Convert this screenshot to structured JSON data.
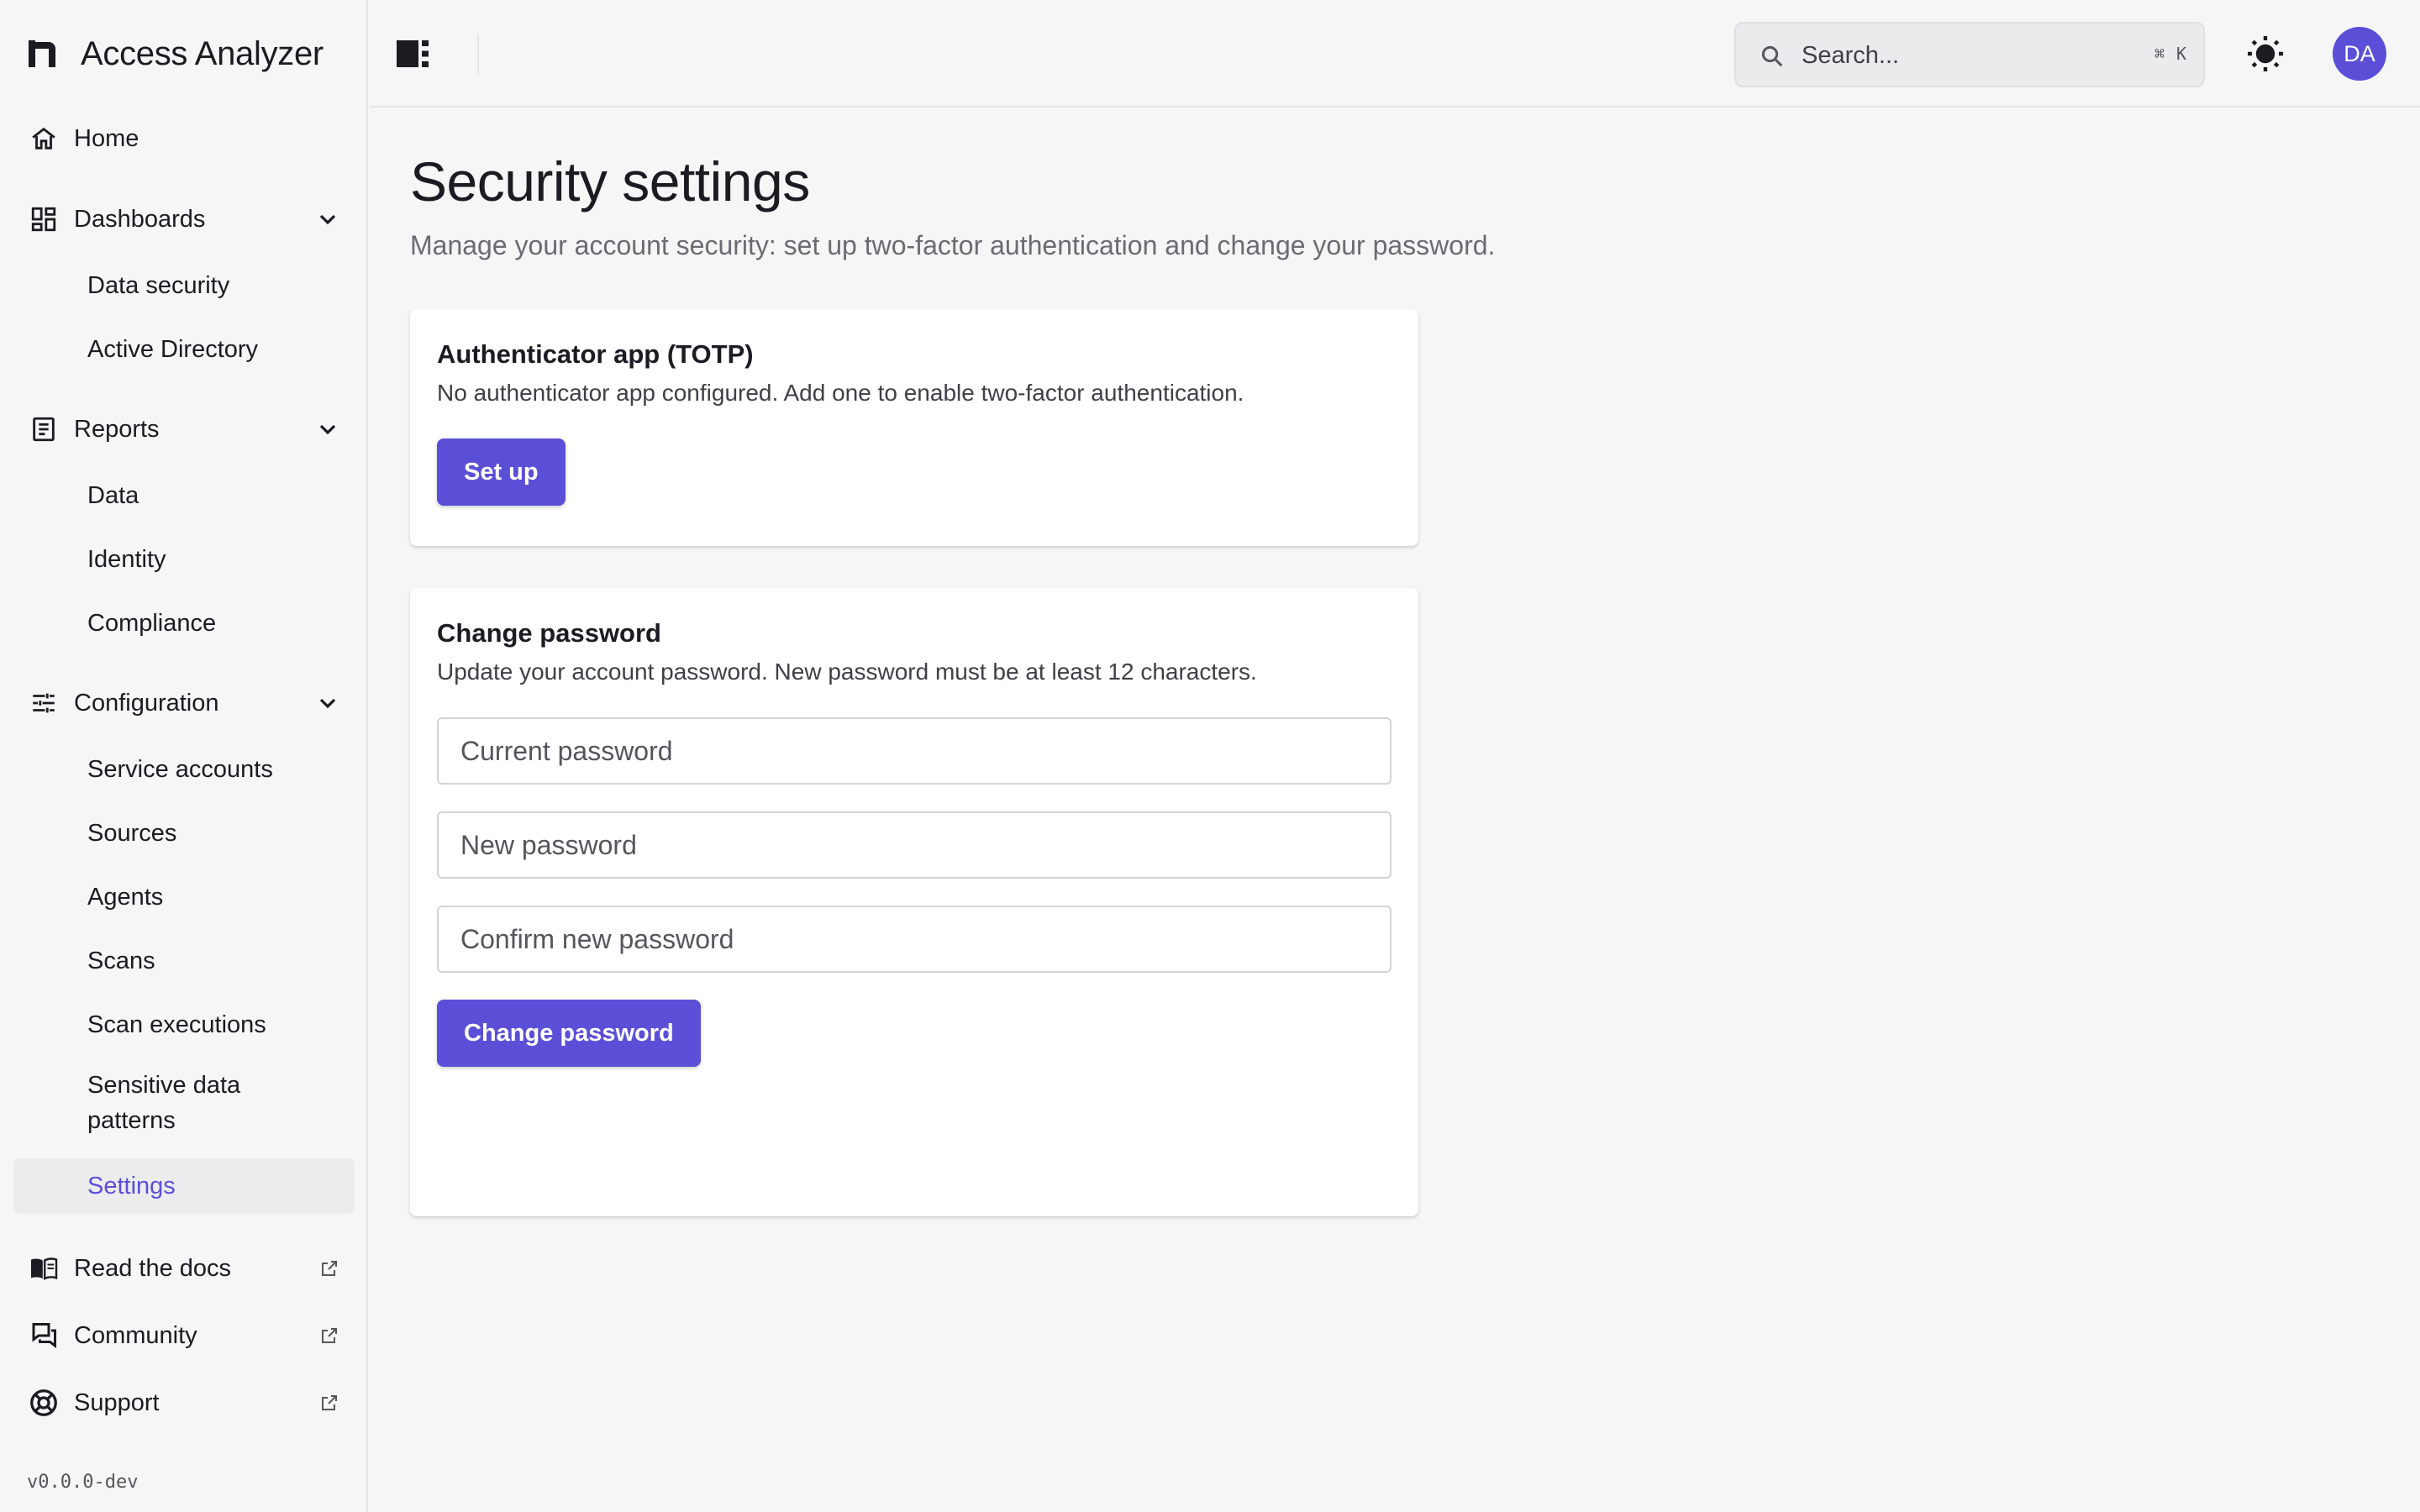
{
  "app": {
    "name": "Access Analyzer",
    "version": "v0.0.0-dev"
  },
  "sidebar": {
    "home": "Home",
    "dashboards": {
      "label": "Dashboards",
      "items": [
        "Data security",
        "Active Directory"
      ]
    },
    "reports": {
      "label": "Reports",
      "items": [
        "Data",
        "Identity",
        "Compliance"
      ]
    },
    "configuration": {
      "label": "Configuration",
      "items": [
        "Service accounts",
        "Sources",
        "Agents",
        "Scans",
        "Scan executions",
        "Sensitive data patterns",
        "Settings"
      ],
      "active": "Settings"
    },
    "external": [
      {
        "label": "Read the docs",
        "icon": "book-icon"
      },
      {
        "label": "Community",
        "icon": "chat-icon"
      },
      {
        "label": "Support",
        "icon": "lifebuoy-icon"
      }
    ]
  },
  "header": {
    "search_placeholder": "Search...",
    "shortcut_mod": "⌘",
    "shortcut_key": "K",
    "avatar_initials": "DA"
  },
  "page": {
    "title": "Security settings",
    "subtitle": "Manage your account security: set up two-factor authentication and change your password."
  },
  "totp": {
    "title": "Authenticator app (TOTP)",
    "description": "No authenticator app configured. Add one to enable two-factor authentication.",
    "button": "Set up"
  },
  "password": {
    "title": "Change password",
    "description": "Update your account password. New password must be at least 12 characters.",
    "current_placeholder": "Current password",
    "new_placeholder": "New password",
    "confirm_placeholder": "Confirm new password",
    "button": "Change password"
  },
  "colors": {
    "accent": "#5b4fd8",
    "background": "#f6f6f6",
    "card": "#ffffff",
    "text": "#1c1b22"
  }
}
